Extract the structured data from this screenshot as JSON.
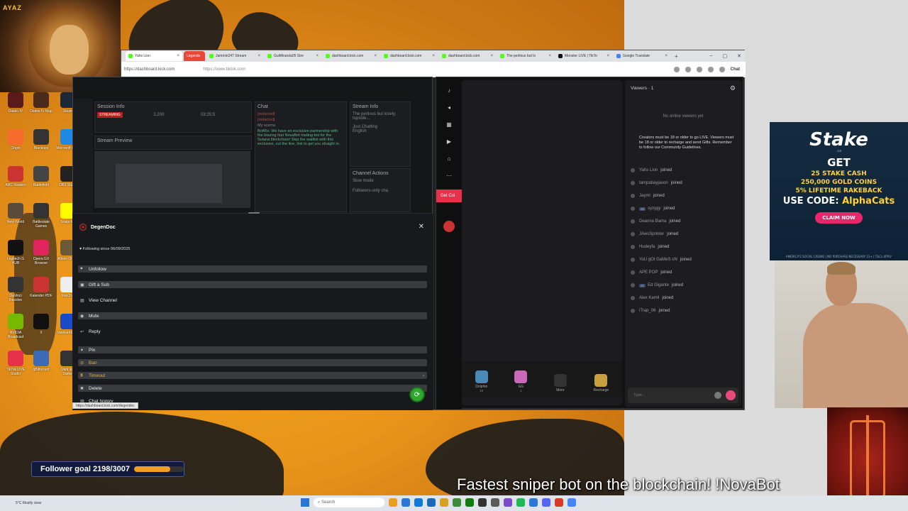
{
  "stream_overlay": {
    "lion_cam_tag": "AYAZ",
    "follower_goal_label": "Follower goal 2198/3007",
    "follower_goal_progress": 0.73,
    "ticker_text": "Fastest sniper bot on the blockchain! !NovaBot"
  },
  "desktop_icons": [
    {
      "label": "Diablo IV",
      "color": "#5a1a1a"
    },
    {
      "label": "Diablo IV Map",
      "color": "#4a2a1a"
    },
    {
      "label": "Steam",
      "color": "#1b2838"
    },
    {
      "label": "Origin",
      "color": "#f56c2d"
    },
    {
      "label": "Blackops",
      "color": "#333"
    },
    {
      "label": "Microsoft Edge",
      "color": "#1e88e5"
    },
    {
      "label": "ARC Raiders",
      "color": "#c33"
    },
    {
      "label": "Battlefield",
      "color": "#444"
    },
    {
      "label": "OBS Studio",
      "color": "#222"
    },
    {
      "label": "New World",
      "color": "#5a4a3a"
    },
    {
      "label": "Battlestate Games",
      "color": "#333"
    },
    {
      "label": "Snapchat",
      "color": "#fffc00"
    },
    {
      "label": "Logitech G HUB",
      "color": "#111"
    },
    {
      "label": "Opera GX Browser",
      "color": "#e0245e"
    },
    {
      "label": "Albion Online",
      "color": "#6a5a3a"
    },
    {
      "label": "DaVinci Resolve",
      "color": "#333"
    },
    {
      "label": "Kalender PDF",
      "color": "#c33"
    },
    {
      "label": "WeChat",
      "color": "#eee"
    },
    {
      "label": "NVIDIA Broadcast",
      "color": "#76b900"
    },
    {
      "label": "X",
      "color": "#111"
    },
    {
      "label": "Malwarebytes",
      "color": "#1a4ac8"
    },
    {
      "label": "TikTok LIVE Studio",
      "color": "#e8304a"
    },
    {
      "label": "qBittorrent",
      "color": "#3a6ab8"
    },
    {
      "label": "Dark and Darker",
      "color": "#333"
    }
  ],
  "browser": {
    "tabs": [
      {
        "label": "Yahs Lion",
        "color": "#53fc18",
        "active": true
      },
      {
        "label": "Legends",
        "color": "#e8483a",
        "special": true
      },
      {
        "label": "Jammin247 Stream",
        "color": "#53fc18"
      },
      {
        "label": "GuiMiranda05 Stre",
        "color": "#53fc18"
      },
      {
        "label": "dashboard.kick.com",
        "color": "#53fc18"
      },
      {
        "label": "dashboard.kick.com",
        "color": "#53fc18"
      },
      {
        "label": "dashboard.kick.com",
        "color": "#53fc18"
      },
      {
        "label": "The perilous but lo",
        "color": "#53fc18"
      },
      {
        "label": "Monster LIVE | TikTo",
        "color": "#111"
      },
      {
        "label": "Google Translate",
        "color": "#4285f4"
      }
    ],
    "url_left": "https://dashboard.kick.com",
    "url_right": "https://www.tiktok.com",
    "chat_label": "Chat"
  },
  "kick_dashboard": {
    "session_info_title": "Session Info",
    "streaming_badge": "STREAMING",
    "viewers_value": "2,200",
    "uptime_value": "03:25:5",
    "stream_preview_title": "Stream Preview",
    "chat_title": "Chat",
    "chat_lines": [
      {
        "text": "[redacted]  ",
        "style": "r"
      },
      {
        "text": "[redacted]  ",
        "style": "r"
      },
      {
        "text": "My scema",
        "style": "w"
      },
      {
        "text": "BotRix: We have an exclusive partnership with the blazing fast NovaBot trading bot for the Solana blockchain! Skip the waitlist with this exclusive, cut the line, link to get you straight in.",
        "style": "g"
      }
    ],
    "stream_info_title": "Stream Info",
    "stream_info_text": "The perilous but lovely, topside...",
    "category_label": "Just Chatting",
    "language_label": "English",
    "channel_actions_title": "Channel Actions",
    "slow_mode_label": "Slow mode",
    "followers_only_label": "Followers-only cha"
  },
  "user_popup": {
    "username": "DegenDoc",
    "following_since": "Following since 06/09/2025",
    "actions": [
      {
        "label": "Unfollow",
        "icon": "heart-icon",
        "bar": true
      },
      {
        "label": "Gift a Sub",
        "icon": "gift-icon",
        "bar": true
      },
      {
        "label": "View Channel",
        "icon": "channel-icon",
        "bar": false
      },
      {
        "label": "Mute",
        "icon": "mute-icon",
        "bar": true
      },
      {
        "label": "Reply",
        "icon": "reply-icon",
        "bar": false
      },
      {
        "label": "Pin",
        "icon": "pin-icon",
        "bar": true
      },
      {
        "label": "Ban",
        "icon": "ban-icon",
        "bar": true,
        "yellow": true
      },
      {
        "label": "Timeout",
        "icon": "timeout-icon",
        "bar": true,
        "yellow": true,
        "chevron": true
      },
      {
        "label": "Delete",
        "icon": "delete-icon",
        "bar": true
      },
      {
        "label": "Chat history",
        "icon": "history-icon",
        "bar": false
      }
    ],
    "status_url": "https://dashboard.kick.com/degendoc"
  },
  "tiktok": {
    "get_coins_label": "Get Coi",
    "viewers_title": "Viewers · 1",
    "no_viewers_text": "No online viewers yet",
    "notice_text": "Creators must be 18 or older to go LIVE. Viewers must be 18 or older to recharge and send Gifts. Remember to follow our Community Guidelines.",
    "joined_label": "joined",
    "viewers": [
      {
        "name": "Yahs Lion"
      },
      {
        "name": "tampabayjason"
      },
      {
        "name": "Jaymi"
      },
      {
        "name": "syzygy",
        "level": "46"
      },
      {
        "name": "Deanna Bama"
      },
      {
        "name": "JAwsSprinter"
      },
      {
        "name": "Hudeyfa"
      },
      {
        "name": "YoU gOt GaMeS oN"
      },
      {
        "name": "APE POP"
      },
      {
        "name": "Ed Gigante",
        "level": "41"
      },
      {
        "name": "Alex Kamil"
      },
      {
        "name": "iTrap_06"
      }
    ],
    "gifts": [
      {
        "label": "Dolphin",
        "price": "10",
        "color": "#4a8ab8"
      },
      {
        "label": "GG",
        "price": "1",
        "color": "#c86ab8"
      },
      {
        "label": "More",
        "price": "",
        "color": "#333"
      },
      {
        "label": "Recharge",
        "price": "",
        "color": "#c8a040"
      }
    ],
    "type_placeholder": "Type..."
  },
  "stake_ad": {
    "logo": "Stake",
    "logo_sub": ".us",
    "get": "GET",
    "line1": "25 STAKE CASH",
    "line2": "250,000 GOLD COINS",
    "line3": "5% LIFETIME RAKEBACK",
    "code_prefix": "USE CODE: ",
    "code": "AlphaCats",
    "claim": "CLAIM NOW",
    "footer": "AMERICA'S SOCIAL CASINO | NO PURCHASE NECESSARY   21+ | T&Cs APPLY"
  },
  "taskbar": {
    "weather": "5°C Mostly clear",
    "search_placeholder": "Search",
    "apps": [
      "#e8a020",
      "#2a78d6",
      "#0f7bd4",
      "#1a6ab8",
      "#d8a020",
      "#3a8a3a",
      "#107c10",
      "#333",
      "#5a5a5a",
      "#7a4ac8",
      "#1db954",
      "#2a78d6",
      "#5865f2",
      "#d83a2a",
      "#4285f4"
    ]
  }
}
